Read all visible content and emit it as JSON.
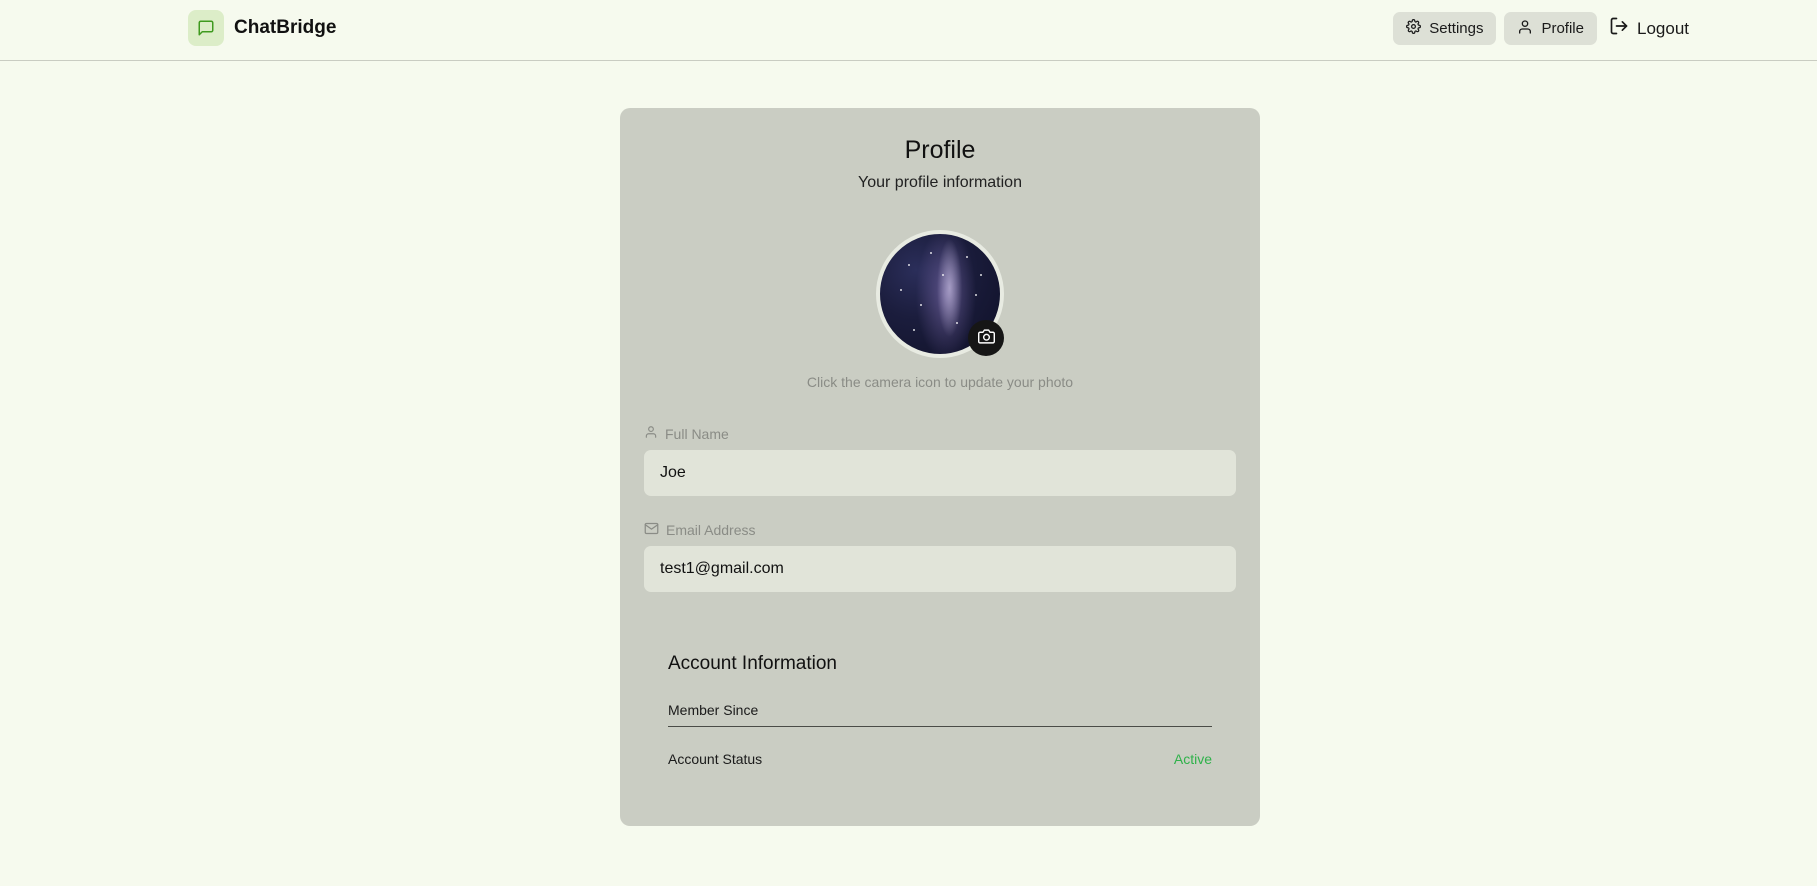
{
  "app": {
    "name": "ChatBridge",
    "accent": "#4caf2a"
  },
  "nav": {
    "settings_label": "Settings",
    "profile_label": "Profile",
    "logout_label": "Logout"
  },
  "profile": {
    "title": "Profile",
    "subtitle": "Your profile information",
    "photo_hint": "Click the camera icon to update your photo"
  },
  "fields": {
    "full_name_label": "Full Name",
    "full_name_value": "Joe",
    "email_label": "Email Address",
    "email_value": "test1@gmail.com"
  },
  "account": {
    "title": "Account Information",
    "member_since_label": "Member Since",
    "member_since_value": "",
    "status_label": "Account Status",
    "status_value": "Active",
    "status_color": "#2fb24a"
  }
}
